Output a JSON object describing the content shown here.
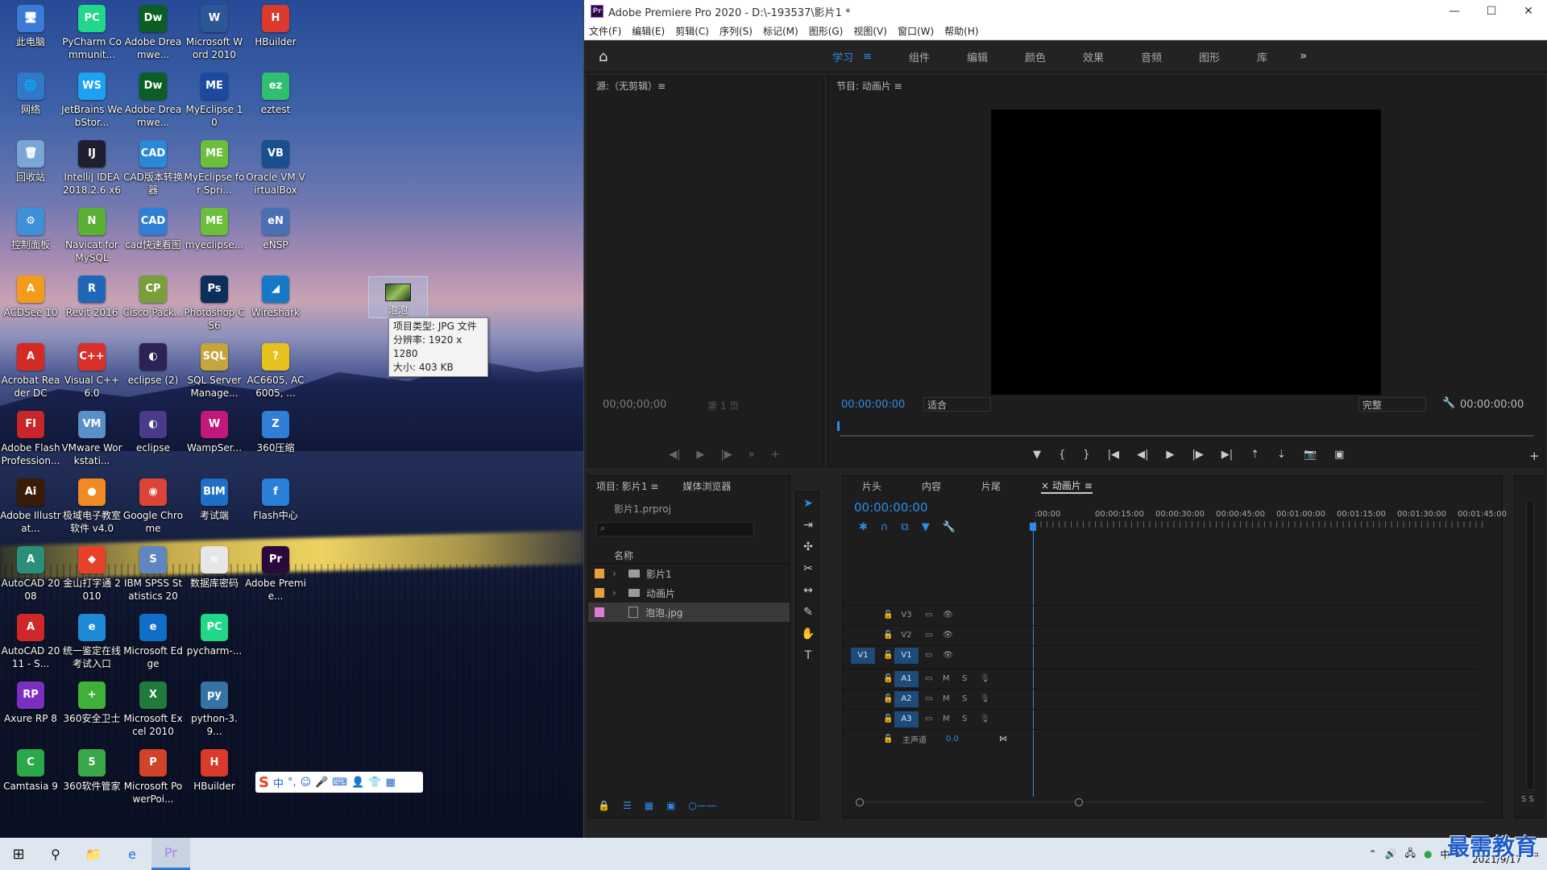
{
  "desktop": {
    "icons": [
      {
        "label": "此电脑",
        "glyph": "🖥",
        "color": "#3a7bd5"
      },
      {
        "label": "PyCharm Communit...",
        "glyph": "PC",
        "color": "#21d789"
      },
      {
        "label": "Adobe Dreamwe...",
        "glyph": "Dw",
        "color": "#0b5f24"
      },
      {
        "label": "Microsoft Word 2010",
        "glyph": "W",
        "color": "#2b5797"
      },
      {
        "label": "HBuilder",
        "glyph": "H",
        "color": "#d93a2b"
      },
      {
        "label": "网络",
        "glyph": "🌐",
        "color": "#2f79c8"
      },
      {
        "label": "JetBrains WebStor...",
        "glyph": "WS",
        "color": "#1da1f2"
      },
      {
        "label": "Adobe Dreamwe...",
        "glyph": "Dw",
        "color": "#0b5f24"
      },
      {
        "label": "MyEclipse 10",
        "glyph": "ME",
        "color": "#1c4a9e"
      },
      {
        "label": "eztest",
        "glyph": "ez",
        "color": "#2fbf71"
      },
      {
        "label": "回收站",
        "glyph": "🗑",
        "color": "#7aa6d6"
      },
      {
        "label": "IntelliJ IDEA 2018.2.6 x64",
        "glyph": "IJ",
        "color": "#1f1f2f"
      },
      {
        "label": "CAD版本转换器",
        "glyph": "CAD",
        "color": "#2a88d8"
      },
      {
        "label": "MyEclipse for Spri...",
        "glyph": "ME",
        "color": "#6bbf3a"
      },
      {
        "label": "Oracle VM VirtualBox",
        "glyph": "VB",
        "color": "#1a4f8f"
      },
      {
        "label": "控制面板",
        "glyph": "⚙",
        "color": "#3d8fd8"
      },
      {
        "label": "Navicat for MySQL",
        "glyph": "N",
        "color": "#5ab031"
      },
      {
        "label": "cad快速看图",
        "glyph": "CAD",
        "color": "#2f7fd6"
      },
      {
        "label": "myeclipse...",
        "glyph": "ME",
        "color": "#6bbf3a"
      },
      {
        "label": "eNSP",
        "glyph": "eN",
        "color": "#4a6fb5"
      },
      {
        "label": "ACDSee 10",
        "glyph": "A",
        "color": "#f39b1b"
      },
      {
        "label": "Revit 2016",
        "glyph": "R",
        "color": "#2067b8"
      },
      {
        "label": "Cisco Pack...",
        "glyph": "CP",
        "color": "#7a9e3a"
      },
      {
        "label": "Photoshop CS6",
        "glyph": "Ps",
        "color": "#0c2e5a"
      },
      {
        "label": "Wireshark",
        "glyph": "◢",
        "color": "#1679c6"
      },
      {
        "label": "Acrobat Reader DC",
        "glyph": "A",
        "color": "#d32b23"
      },
      {
        "label": "Visual C++ 6.0",
        "glyph": "C++",
        "color": "#d9302b"
      },
      {
        "label": "eclipse (2)",
        "glyph": "◐",
        "color": "#2c2255"
      },
      {
        "label": "SQL Server Manage...",
        "glyph": "SQL",
        "color": "#c8a53a"
      },
      {
        "label": "AC6605, AC6005, ...",
        "glyph": "?",
        "color": "#e6c21e"
      },
      {
        "label": "Adobe Flash Profession...",
        "glyph": "Fl",
        "color": "#c8262a"
      },
      {
        "label": "VMware Workstati...",
        "glyph": "VM",
        "color": "#5a8fc8"
      },
      {
        "label": "eclipse",
        "glyph": "◐",
        "color": "#4a3a8a"
      },
      {
        "label": "WampSer...",
        "glyph": "W",
        "color": "#c2187a"
      },
      {
        "label": "360压缩",
        "glyph": "Z",
        "color": "#2f7fd6"
      },
      {
        "label": "Adobe Illustrat...",
        "glyph": "Ai",
        "color": "#3a1c06"
      },
      {
        "label": "极域电子教室软件 v4.0 2...",
        "glyph": "●",
        "color": "#f08a24"
      },
      {
        "label": "Google Chrome",
        "glyph": "◉",
        "color": "#db4437"
      },
      {
        "label": "考试端",
        "glyph": "BIM",
        "color": "#1f6fc8"
      },
      {
        "label": "Flash中心",
        "glyph": "f",
        "color": "#2a7fd8"
      },
      {
        "label": "AutoCAD 2008",
        "glyph": "A",
        "color": "#2a8f7a"
      },
      {
        "label": "金山打字通 2010",
        "glyph": "◆",
        "color": "#e8412a"
      },
      {
        "label": "IBM SPSS Statistics 20",
        "glyph": "S",
        "color": "#5e86c0"
      },
      {
        "label": "数据库密码",
        "glyph": "≡",
        "color": "#e6e6e6"
      },
      {
        "label": "Adobe Premie...",
        "glyph": "Pr",
        "color": "#2a0a3a"
      },
      {
        "label": "AutoCAD 2011 - S...",
        "glyph": "A",
        "color": "#d02828"
      },
      {
        "label": "统一鉴定在线考试入口",
        "glyph": "e",
        "color": "#1f8ad6"
      },
      {
        "label": "Microsoft Edge",
        "glyph": "e",
        "color": "#0f6fc8"
      },
      {
        "label": "pycharm-...",
        "glyph": "PC",
        "color": "#21d789"
      },
      {
        "label": "",
        "glyph": "",
        "color": "transparent"
      },
      {
        "label": "Axure RP 8",
        "glyph": "RP",
        "color": "#7a2fc0"
      },
      {
        "label": "360安全卫士",
        "glyph": "+",
        "color": "#3fb13a"
      },
      {
        "label": "Microsoft Excel 2010",
        "glyph": "X",
        "color": "#1f7a3c"
      },
      {
        "label": "python-3.9...",
        "glyph": "py",
        "color": "#3673a5"
      },
      {
        "label": "",
        "glyph": "",
        "color": "transparent"
      },
      {
        "label": "Camtasia 9",
        "glyph": "C",
        "color": "#2aa84a"
      },
      {
        "label": "360软件管家",
        "glyph": "5",
        "color": "#3aa84a"
      },
      {
        "label": "Microsoft PowerPoi...",
        "glyph": "P",
        "color": "#d0442a"
      },
      {
        "label": "HBuilder",
        "glyph": "H",
        "color": "#d93a2b"
      },
      {
        "label": "",
        "glyph": "",
        "color": "transparent"
      }
    ],
    "selected_file": {
      "label": "泡泡"
    },
    "tooltip": {
      "type": "项目类型: JPG 文件",
      "resolution": "分辨率: 1920 x 1280",
      "size": "大小: 403 KB"
    },
    "ime": {
      "logo": "S",
      "items": [
        "中",
        "°,",
        "☺",
        "🎤",
        "⌨",
        "👤",
        "👕",
        "▦"
      ]
    }
  },
  "app": {
    "title": "Adobe Premiere Pro 2020 - D:\\-193537\\影片1 *",
    "window_controls": [
      "—",
      "☐",
      "✕"
    ],
    "menu": [
      "文件(F)",
      "编辑(E)",
      "剪辑(C)",
      "序列(S)",
      "标记(M)",
      "图形(G)",
      "视图(V)",
      "窗口(W)",
      "帮助(H)"
    ],
    "workspaces": [
      {
        "label": "学习",
        "active": true
      },
      {
        "label": "≡",
        "active": true
      },
      {
        "label": "组件",
        "active": false
      },
      {
        "label": "编辑",
        "active": false
      },
      {
        "label": "颜色",
        "active": false
      },
      {
        "label": "效果",
        "active": false
      },
      {
        "label": "音频",
        "active": false
      },
      {
        "label": "图形",
        "active": false
      },
      {
        "label": "库",
        "active": false
      }
    ],
    "source": {
      "title": "源:（无剪辑）≡",
      "timecode": "00;00;00;00",
      "page": "第 1 页"
    },
    "program": {
      "title": "节目: 动画片 ≡",
      "timecode_left": "00:00:00:00",
      "fit": "适合",
      "quality": "完整",
      "timecode_right": "00:00:00:00"
    },
    "project": {
      "tabs": [
        "项目: 影片1 ≡",
        "媒体浏览器"
      ],
      "proj_file": "影片1.prproj",
      "col_name": "名称",
      "items": [
        {
          "name": "影片1",
          "type": "folder",
          "color": "#e8a03a",
          "selected": false
        },
        {
          "name": "动画片",
          "type": "folder",
          "color": "#e8a03a",
          "selected": false
        },
        {
          "name": "泡泡.jpg",
          "type": "image",
          "color": "#e07ad6",
          "selected": true
        }
      ]
    },
    "timeline": {
      "tabs": [
        {
          "label": "片头",
          "active": false
        },
        {
          "label": "内容",
          "active": false
        },
        {
          "label": "片尾",
          "active": false
        },
        {
          "label": "× 动画片 ≡",
          "active": true
        }
      ],
      "timecode": "00:00:00:00",
      "ruler": [
        ":00:00",
        "00:00:15:00",
        "00:00:30:00",
        "00:00:45:00",
        "00:01:00:00",
        "00:01:15:00",
        "00:01:30:00",
        "00:01:45:00"
      ],
      "video_tracks": [
        "V3",
        "V2",
        "V1"
      ],
      "audio_tracks": [
        "A1",
        "A2",
        "A3"
      ],
      "master": {
        "label": "主声道",
        "value": "0.0"
      },
      "source_patch": {
        "video": "V1",
        "audio": ""
      }
    },
    "meter": {
      "label": "S S"
    }
  },
  "taskbar": {
    "date": "2021/9/17",
    "watermark": "最需教育"
  }
}
